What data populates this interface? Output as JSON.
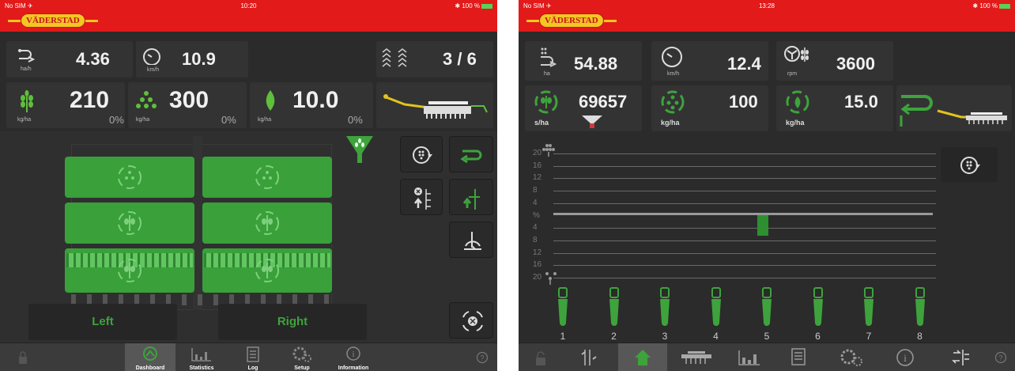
{
  "left": {
    "status": {
      "carrier": "No SIM ✈",
      "time": "10:20",
      "battery": "✱ 100 %"
    },
    "brand": "VÄDERSTAD",
    "row1": [
      {
        "icon": "area-rate-icon",
        "unit": "ha/h",
        "value": "4.36"
      },
      {
        "icon": "speedometer-icon",
        "unit": "km/h",
        "value": "10.9"
      },
      {
        "icon": "row-count-icon",
        "value": "3 / 6"
      }
    ],
    "row2": [
      {
        "icon": "seed-icon",
        "unit": "kg/ha",
        "value": "210",
        "pct": "0%"
      },
      {
        "icon": "fertilizer-icon",
        "unit": "kg/ha",
        "value": "300",
        "pct": "0%"
      },
      {
        "icon": "microgranule-icon",
        "unit": "kg/ha",
        "value": "10.0",
        "pct": "0%"
      }
    ],
    "buttons": {
      "left": "Left",
      "right": "Right"
    },
    "tabs": [
      {
        "label": "",
        "icon": "lock-icon"
      },
      {
        "label": "Dashboard",
        "icon": "dashboard-icon"
      },
      {
        "label": "Statistics",
        "icon": "statistics-icon"
      },
      {
        "label": "Log",
        "icon": "log-icon"
      },
      {
        "label": "Setup",
        "icon": "setup-icon"
      },
      {
        "label": "Information",
        "icon": "info-icon"
      },
      {
        "label": "",
        "icon": "help-icon"
      }
    ]
  },
  "right": {
    "status": {
      "carrier": "No SIM ✈",
      "time": "13:28",
      "battery": "✱ 100 %"
    },
    "brand": "VÄDERSTAD",
    "row1": [
      {
        "icon": "area-rate-icon",
        "unit": "ha",
        "value": "54.88"
      },
      {
        "icon": "speedometer-icon",
        "unit": "km/h",
        "value": "12.4"
      },
      {
        "icon": "fan-icon",
        "unit": "rpm",
        "value": "3600"
      }
    ],
    "row2": [
      {
        "icon": "seed-rate-icon",
        "unit": "s/ha",
        "value": "69657"
      },
      {
        "icon": "fertilizer-rate-icon",
        "unit": "kg/ha",
        "value": "100"
      },
      {
        "icon": "microgranule-rate-icon",
        "unit": "kg/ha",
        "value": "15.0"
      }
    ],
    "scale_labels": [
      "20",
      "16",
      "12",
      "8",
      "4",
      "%",
      "4",
      "8",
      "12",
      "16",
      "20"
    ],
    "sensors": [
      "1",
      "2",
      "3",
      "4",
      "5",
      "6",
      "7",
      "8"
    ],
    "tabs": [
      {
        "icon": "lock-icon"
      },
      {
        "icon": "seed-sensor-icon"
      },
      {
        "icon": "home-icon"
      },
      {
        "icon": "drill-icon"
      },
      {
        "icon": "statistics-icon"
      },
      {
        "icon": "log-icon"
      },
      {
        "icon": "setup-icon"
      },
      {
        "icon": "info-icon"
      },
      {
        "icon": "calibration-icon"
      },
      {
        "icon": "help-icon"
      }
    ]
  }
}
